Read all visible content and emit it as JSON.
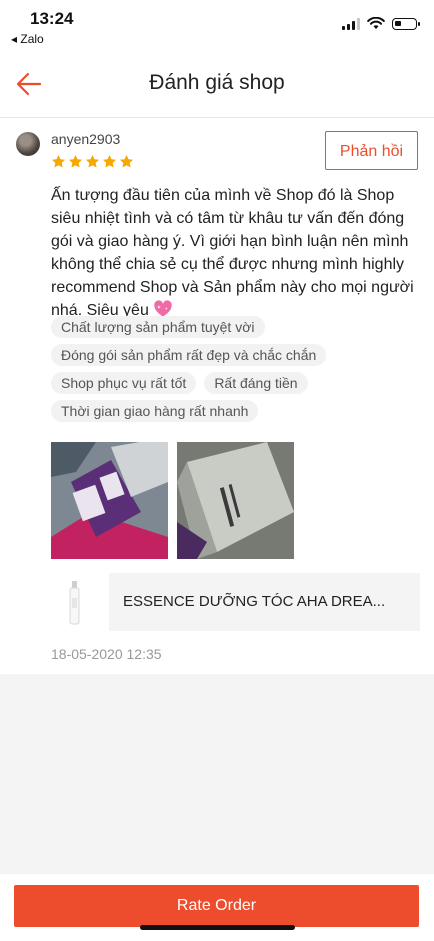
{
  "status": {
    "time": "13:24",
    "back_app": "◂ Zalo"
  },
  "nav": {
    "title": "Đánh giá shop"
  },
  "review": {
    "username": "anyen2903",
    "rating": 5,
    "reply_label": "Phản hồi",
    "comment": "Ấn tượng đầu tiên của mình về Shop đó là Shop siêu nhiệt tình và có tâm từ khâu tư vấn đến đóng gói và giao hàng ý. Vì giới hạn bình luận nên mình không thể chia sẻ cụ thể được nhưng mình highly recommend Shop và Sản phẩm này cho mọi người nhá. Siêu yêu",
    "tags": [
      "Chất lượng sản phẩm tuyệt vời",
      "Đóng gói sản phẩm rất đẹp và chắc chắn",
      "Shop phục vụ rất tốt",
      "Rất đáng tiền",
      "Thời gian giao hàng rất nhanh"
    ],
    "product_name": "ESSENCE DƯỠNG TÓC AHA DREA...",
    "time": "18-05-2020 12:35"
  },
  "footer": {
    "rate_label": "Rate Order"
  },
  "colors": {
    "accent": "#ee4d2d",
    "star": "#f6a700"
  }
}
